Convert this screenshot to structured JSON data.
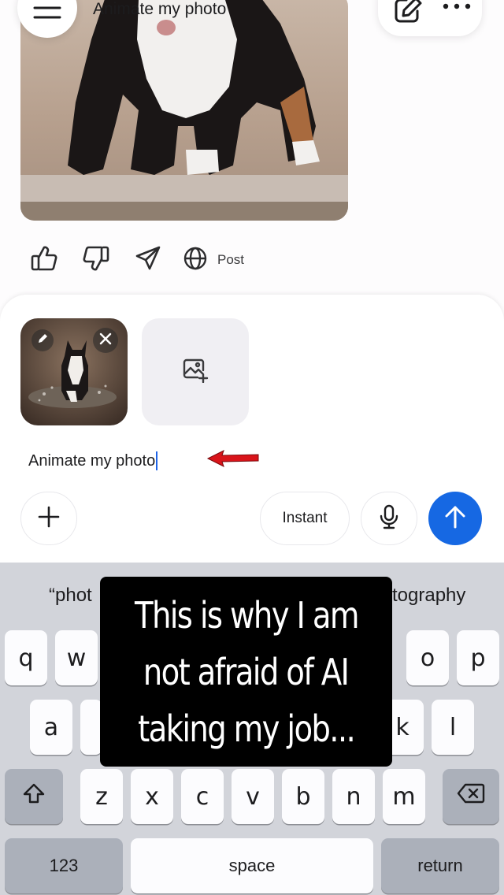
{
  "header": {
    "title": "Animate my photo",
    "icons": {
      "menu": "hamburger-icon",
      "edit": "compose-icon",
      "more": "more-dots-icon"
    }
  },
  "feedback": {
    "post_label": "Post",
    "icons": [
      "thumbs-up-icon",
      "thumbs-down-icon",
      "share-icon",
      "globe-icon"
    ]
  },
  "composer": {
    "prompt_text": "Animate my photo",
    "mode_label": "Instant",
    "icons": {
      "add": "plus-icon",
      "add_image": "add-image-icon",
      "mic": "microphone-icon",
      "send": "arrow-up-icon"
    },
    "accent_color": "#1668e3"
  },
  "keyboard": {
    "suggestions": [
      "“phot",
      "tography"
    ],
    "row1": [
      "q",
      "w",
      "o",
      "p"
    ],
    "row2": [
      "a",
      "k",
      "l"
    ],
    "row3": [
      "z",
      "x",
      "c",
      "v",
      "b",
      "n",
      "m"
    ],
    "numbers_label": "123",
    "space_label": "space",
    "return_label": "return"
  },
  "overlay": {
    "lines": [
      "This is why I am",
      "not afraid of AI",
      "taking my job..."
    ]
  }
}
